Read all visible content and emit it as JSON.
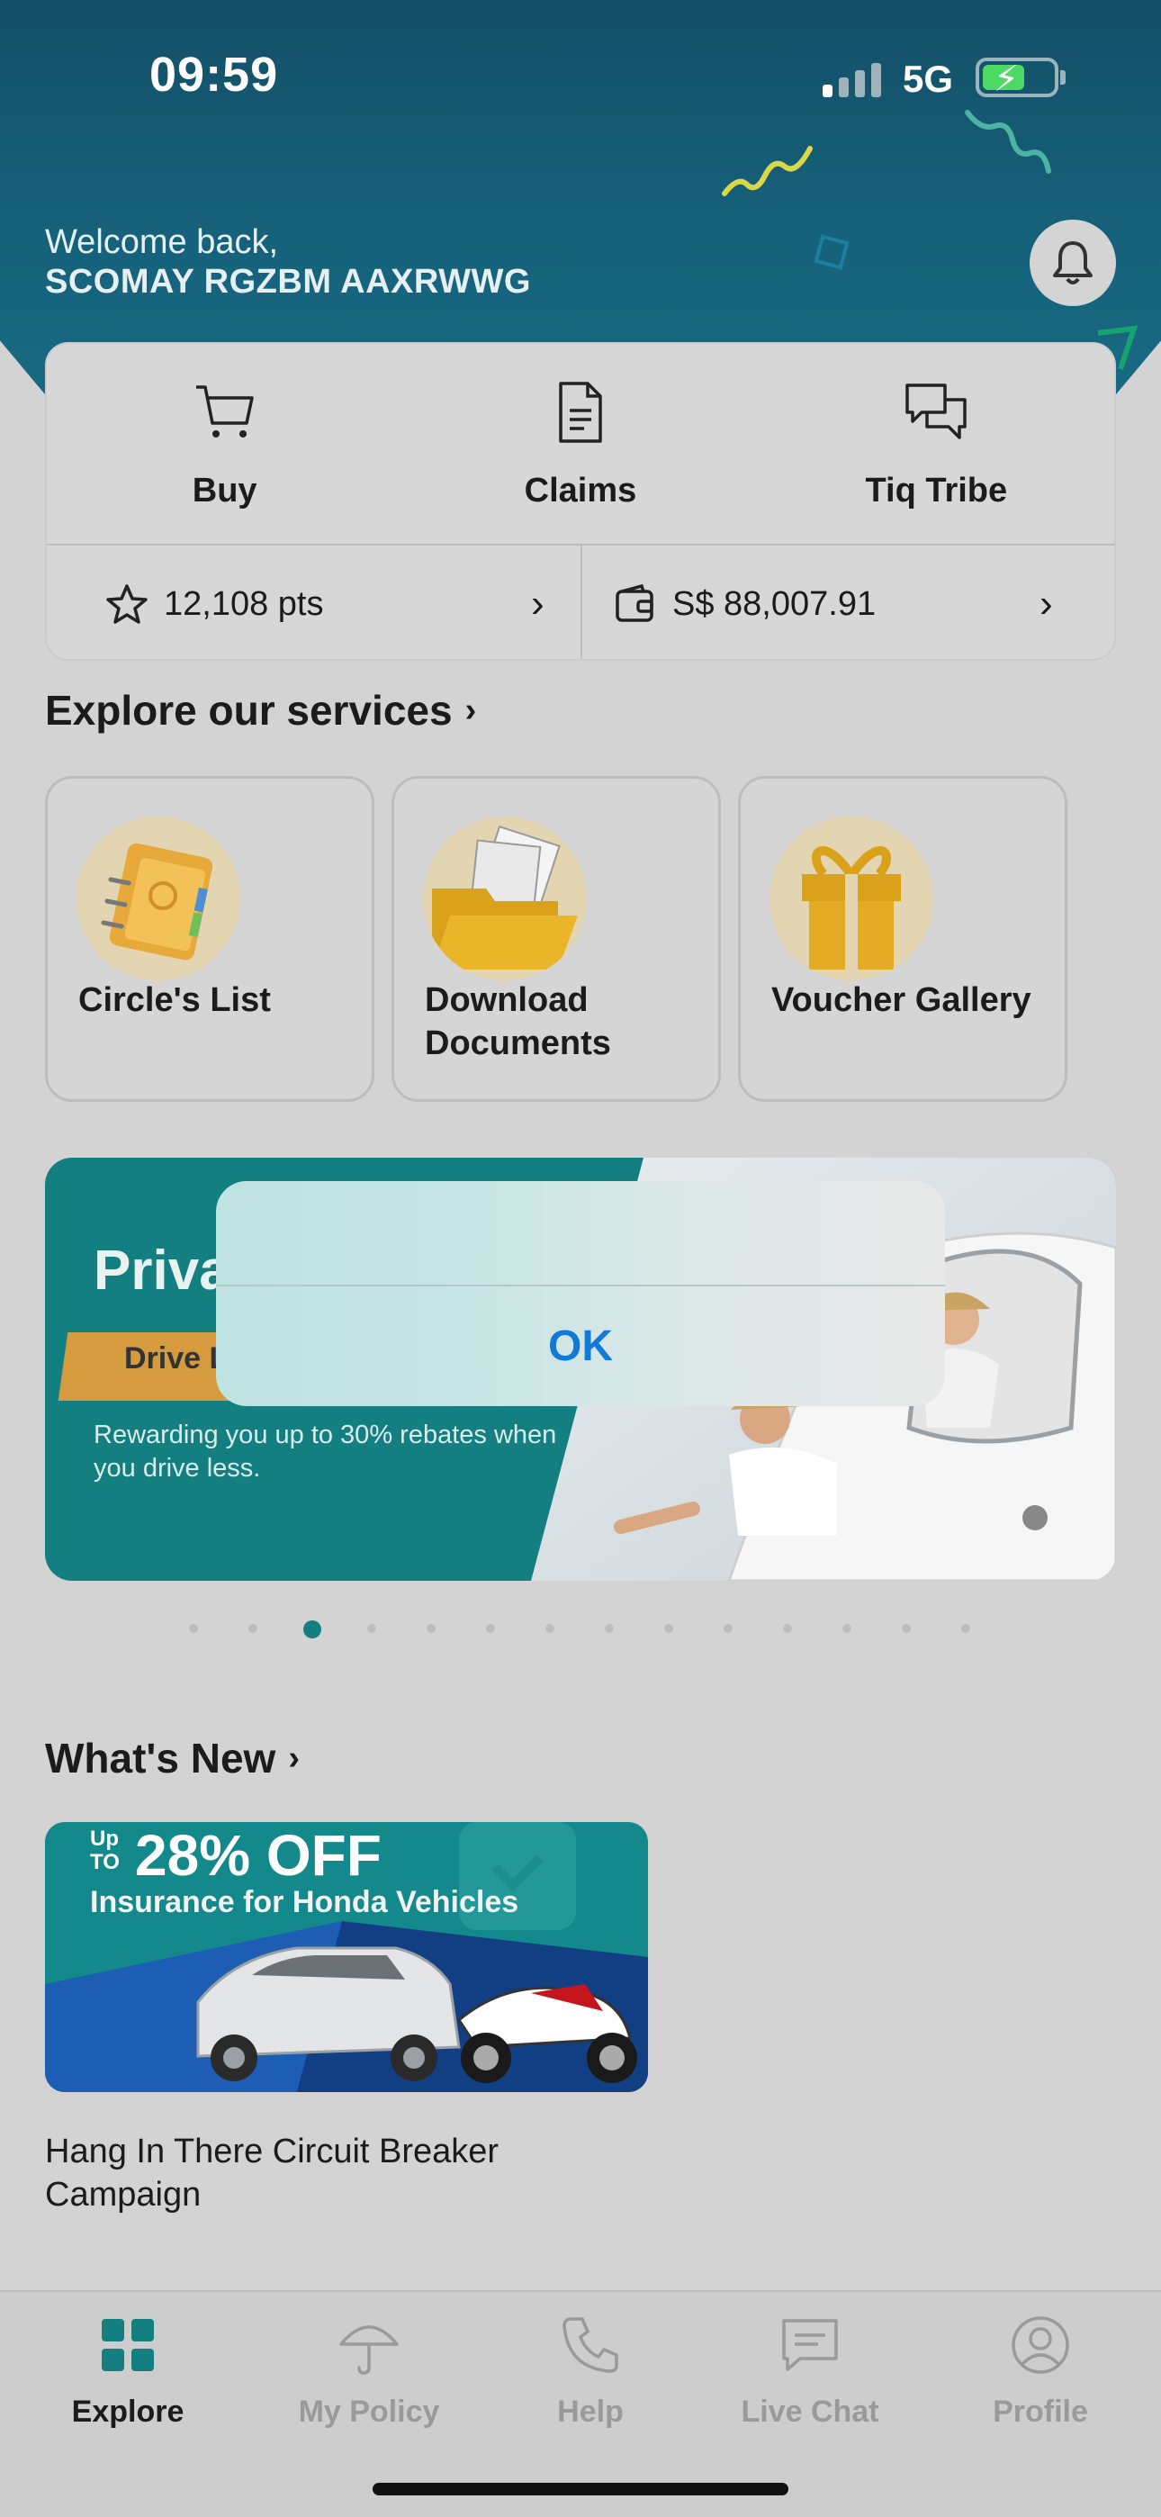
{
  "status_bar": {
    "time": "09:59",
    "network": "5G",
    "battery_icon": "battery-charging-icon"
  },
  "header": {
    "welcome": "Welcome back,",
    "user_name": "SCOMAY RGZBM AAXRWWG",
    "bell_icon": "bell-icon"
  },
  "quick_actions": {
    "items": [
      {
        "label": "Buy",
        "icon": "cart-icon"
      },
      {
        "label": "Claims",
        "icon": "document-icon"
      },
      {
        "label": "Tiq Tribe",
        "icon": "chat-bubbles-icon"
      }
    ],
    "points": "12,108 pts",
    "wallet": "S$ 88,007.91"
  },
  "services": {
    "title": "Explore our services",
    "items": [
      {
        "label": "Circle's List",
        "icon": "address-book-icon"
      },
      {
        "label": "Download Documents",
        "icon": "folder-icon"
      },
      {
        "label": "Voucher Gallery",
        "icon": "gift-icon"
      }
    ]
  },
  "banner": {
    "title": "Priva",
    "tag": "Drive L",
    "subtitle": "Rewarding you up to 30% rebates when you drive less.",
    "dot_count": 14,
    "active_dot": 2
  },
  "alert": {
    "ok_label": "OK"
  },
  "whats_new": {
    "title": "What's New",
    "promo_upto": "Up TO",
    "promo_off": "28% OFF",
    "promo_sub": "Insurance for Honda Vehicles",
    "caption": "Hang In There Circuit Breaker Campaign"
  },
  "tabbar": {
    "items": [
      {
        "label": "Explore",
        "icon": "grid-icon",
        "active": true
      },
      {
        "label": "My Policy",
        "icon": "umbrella-icon",
        "active": false
      },
      {
        "label": "Help",
        "icon": "phone-icon",
        "active": false
      },
      {
        "label": "Live Chat",
        "icon": "message-icon",
        "active": false
      },
      {
        "label": "Profile",
        "icon": "user-icon",
        "active": false
      }
    ]
  },
  "colors": {
    "brand_teal": "#137f80",
    "header_dark": "#134f66",
    "ios_blue": "#1279d8",
    "battery_green": "#4cd964"
  }
}
